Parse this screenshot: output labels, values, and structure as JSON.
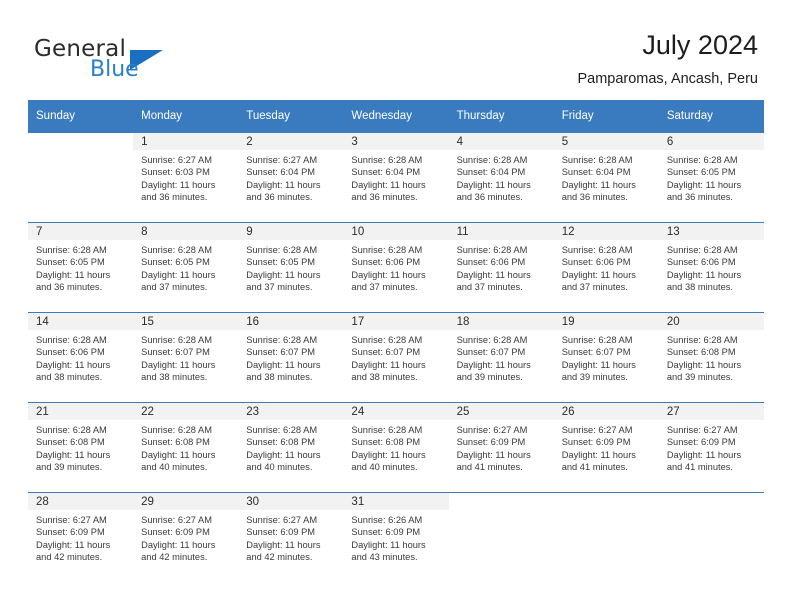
{
  "brand": {
    "name_part1": "General",
    "name_part2": "Blue",
    "triangle_icon": "blue-triangle-icon",
    "colors": {
      "text": "#2b2b2b",
      "blue": "#2a7fc9",
      "triangle": "#1b6fc0"
    }
  },
  "header": {
    "title": "July 2024",
    "subtitle": "Pamparomas, Ancash, Peru"
  },
  "theme": {
    "header_blue": "#3a7bbf",
    "daynum_band": "#f2f2f2",
    "text": "#3a3a3a"
  },
  "weekdays": [
    "Sunday",
    "Monday",
    "Tuesday",
    "Wednesday",
    "Thursday",
    "Friday",
    "Saturday"
  ],
  "weeks": [
    [
      {
        "day": ""
      },
      {
        "day": "1",
        "sunrise": "Sunrise: 6:27 AM",
        "sunset": "Sunset: 6:03 PM",
        "daylight_line1": "Daylight: 11 hours",
        "daylight_line2": "and 36 minutes."
      },
      {
        "day": "2",
        "sunrise": "Sunrise: 6:27 AM",
        "sunset": "Sunset: 6:04 PM",
        "daylight_line1": "Daylight: 11 hours",
        "daylight_line2": "and 36 minutes."
      },
      {
        "day": "3",
        "sunrise": "Sunrise: 6:28 AM",
        "sunset": "Sunset: 6:04 PM",
        "daylight_line1": "Daylight: 11 hours",
        "daylight_line2": "and 36 minutes."
      },
      {
        "day": "4",
        "sunrise": "Sunrise: 6:28 AM",
        "sunset": "Sunset: 6:04 PM",
        "daylight_line1": "Daylight: 11 hours",
        "daylight_line2": "and 36 minutes."
      },
      {
        "day": "5",
        "sunrise": "Sunrise: 6:28 AM",
        "sunset": "Sunset: 6:04 PM",
        "daylight_line1": "Daylight: 11 hours",
        "daylight_line2": "and 36 minutes."
      },
      {
        "day": "6",
        "sunrise": "Sunrise: 6:28 AM",
        "sunset": "Sunset: 6:05 PM",
        "daylight_line1": "Daylight: 11 hours",
        "daylight_line2": "and 36 minutes."
      }
    ],
    [
      {
        "day": "7",
        "sunrise": "Sunrise: 6:28 AM",
        "sunset": "Sunset: 6:05 PM",
        "daylight_line1": "Daylight: 11 hours",
        "daylight_line2": "and 36 minutes."
      },
      {
        "day": "8",
        "sunrise": "Sunrise: 6:28 AM",
        "sunset": "Sunset: 6:05 PM",
        "daylight_line1": "Daylight: 11 hours",
        "daylight_line2": "and 37 minutes."
      },
      {
        "day": "9",
        "sunrise": "Sunrise: 6:28 AM",
        "sunset": "Sunset: 6:05 PM",
        "daylight_line1": "Daylight: 11 hours",
        "daylight_line2": "and 37 minutes."
      },
      {
        "day": "10",
        "sunrise": "Sunrise: 6:28 AM",
        "sunset": "Sunset: 6:06 PM",
        "daylight_line1": "Daylight: 11 hours",
        "daylight_line2": "and 37 minutes."
      },
      {
        "day": "11",
        "sunrise": "Sunrise: 6:28 AM",
        "sunset": "Sunset: 6:06 PM",
        "daylight_line1": "Daylight: 11 hours",
        "daylight_line2": "and 37 minutes."
      },
      {
        "day": "12",
        "sunrise": "Sunrise: 6:28 AM",
        "sunset": "Sunset: 6:06 PM",
        "daylight_line1": "Daylight: 11 hours",
        "daylight_line2": "and 37 minutes."
      },
      {
        "day": "13",
        "sunrise": "Sunrise: 6:28 AM",
        "sunset": "Sunset: 6:06 PM",
        "daylight_line1": "Daylight: 11 hours",
        "daylight_line2": "and 38 minutes."
      }
    ],
    [
      {
        "day": "14",
        "sunrise": "Sunrise: 6:28 AM",
        "sunset": "Sunset: 6:06 PM",
        "daylight_line1": "Daylight: 11 hours",
        "daylight_line2": "and 38 minutes."
      },
      {
        "day": "15",
        "sunrise": "Sunrise: 6:28 AM",
        "sunset": "Sunset: 6:07 PM",
        "daylight_line1": "Daylight: 11 hours",
        "daylight_line2": "and 38 minutes."
      },
      {
        "day": "16",
        "sunrise": "Sunrise: 6:28 AM",
        "sunset": "Sunset: 6:07 PM",
        "daylight_line1": "Daylight: 11 hours",
        "daylight_line2": "and 38 minutes."
      },
      {
        "day": "17",
        "sunrise": "Sunrise: 6:28 AM",
        "sunset": "Sunset: 6:07 PM",
        "daylight_line1": "Daylight: 11 hours",
        "daylight_line2": "and 38 minutes."
      },
      {
        "day": "18",
        "sunrise": "Sunrise: 6:28 AM",
        "sunset": "Sunset: 6:07 PM",
        "daylight_line1": "Daylight: 11 hours",
        "daylight_line2": "and 39 minutes."
      },
      {
        "day": "19",
        "sunrise": "Sunrise: 6:28 AM",
        "sunset": "Sunset: 6:07 PM",
        "daylight_line1": "Daylight: 11 hours",
        "daylight_line2": "and 39 minutes."
      },
      {
        "day": "20",
        "sunrise": "Sunrise: 6:28 AM",
        "sunset": "Sunset: 6:08 PM",
        "daylight_line1": "Daylight: 11 hours",
        "daylight_line2": "and 39 minutes."
      }
    ],
    [
      {
        "day": "21",
        "sunrise": "Sunrise: 6:28 AM",
        "sunset": "Sunset: 6:08 PM",
        "daylight_line1": "Daylight: 11 hours",
        "daylight_line2": "and 39 minutes."
      },
      {
        "day": "22",
        "sunrise": "Sunrise: 6:28 AM",
        "sunset": "Sunset: 6:08 PM",
        "daylight_line1": "Daylight: 11 hours",
        "daylight_line2": "and 40 minutes."
      },
      {
        "day": "23",
        "sunrise": "Sunrise: 6:28 AM",
        "sunset": "Sunset: 6:08 PM",
        "daylight_line1": "Daylight: 11 hours",
        "daylight_line2": "and 40 minutes."
      },
      {
        "day": "24",
        "sunrise": "Sunrise: 6:28 AM",
        "sunset": "Sunset: 6:08 PM",
        "daylight_line1": "Daylight: 11 hours",
        "daylight_line2": "and 40 minutes."
      },
      {
        "day": "25",
        "sunrise": "Sunrise: 6:27 AM",
        "sunset": "Sunset: 6:09 PM",
        "daylight_line1": "Daylight: 11 hours",
        "daylight_line2": "and 41 minutes."
      },
      {
        "day": "26",
        "sunrise": "Sunrise: 6:27 AM",
        "sunset": "Sunset: 6:09 PM",
        "daylight_line1": "Daylight: 11 hours",
        "daylight_line2": "and 41 minutes."
      },
      {
        "day": "27",
        "sunrise": "Sunrise: 6:27 AM",
        "sunset": "Sunset: 6:09 PM",
        "daylight_line1": "Daylight: 11 hours",
        "daylight_line2": "and 41 minutes."
      }
    ],
    [
      {
        "day": "28",
        "sunrise": "Sunrise: 6:27 AM",
        "sunset": "Sunset: 6:09 PM",
        "daylight_line1": "Daylight: 11 hours",
        "daylight_line2": "and 42 minutes."
      },
      {
        "day": "29",
        "sunrise": "Sunrise: 6:27 AM",
        "sunset": "Sunset: 6:09 PM",
        "daylight_line1": "Daylight: 11 hours",
        "daylight_line2": "and 42 minutes."
      },
      {
        "day": "30",
        "sunrise": "Sunrise: 6:27 AM",
        "sunset": "Sunset: 6:09 PM",
        "daylight_line1": "Daylight: 11 hours",
        "daylight_line2": "and 42 minutes."
      },
      {
        "day": "31",
        "sunrise": "Sunrise: 6:26 AM",
        "sunset": "Sunset: 6:09 PM",
        "daylight_line1": "Daylight: 11 hours",
        "daylight_line2": "and 43 minutes."
      },
      {
        "day": ""
      },
      {
        "day": ""
      },
      {
        "day": ""
      }
    ]
  ]
}
